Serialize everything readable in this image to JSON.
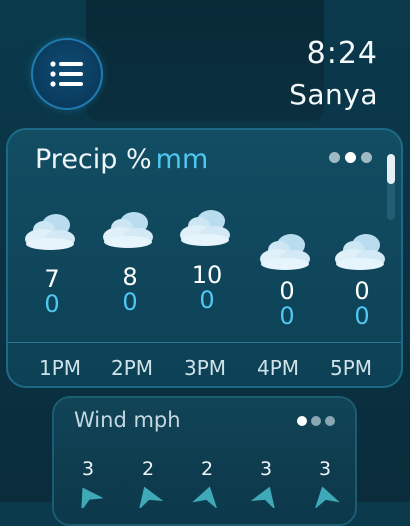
{
  "header": {
    "time": "8:24",
    "city": "Sanya",
    "menu_icon": "list-icon"
  },
  "precip": {
    "title": "Precip %",
    "unit": "mm",
    "page_dots": 3,
    "active_dot": 1,
    "icon": "cloud-icon",
    "columns": [
      {
        "hour": "1PM",
        "percent": "7",
        "amount": "0"
      },
      {
        "hour": "2PM",
        "percent": "8",
        "amount": "0"
      },
      {
        "hour": "3PM",
        "percent": "10",
        "amount": "0"
      },
      {
        "hour": "4PM",
        "percent": "0",
        "amount": "0"
      },
      {
        "hour": "5PM",
        "percent": "0",
        "amount": "0"
      }
    ],
    "colors": {
      "accent": "#4fc7f0",
      "card_border": "#1c6b86"
    }
  },
  "wind": {
    "title": "Wind mph",
    "page_dots": 3,
    "active_dot": 0,
    "icon": "wind-arrow-icon",
    "values": [
      "3",
      "2",
      "2",
      "3",
      "3"
    ],
    "colors": {
      "arrow": "#3fa9b8"
    }
  }
}
